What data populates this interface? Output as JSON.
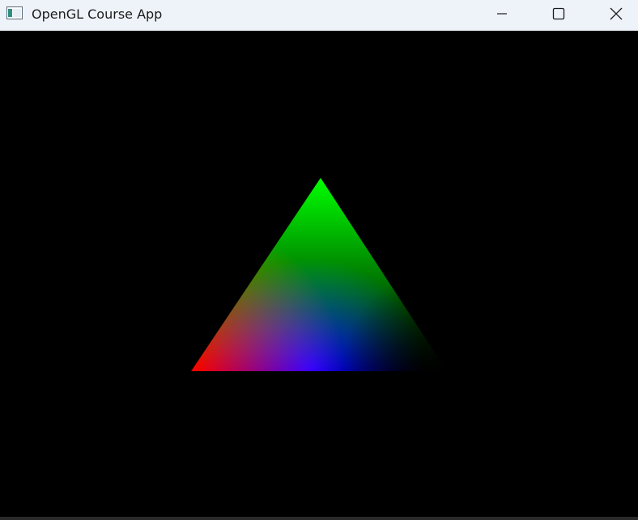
{
  "window": {
    "title": "OpenGL Course App",
    "app_icon": "window-app-icon",
    "titlebar_color": "#eef3fa",
    "controls": {
      "minimize": "minimize-icon",
      "maximize": "maximize-icon",
      "close": "close-icon"
    }
  },
  "scene": {
    "background_color": "#000000",
    "triangle": {
      "vertex_colors": {
        "top": "#00ff00",
        "bottom_left": "#ff0000",
        "bottom_right": "#000000",
        "bottom_center": "#0000ff"
      }
    }
  }
}
